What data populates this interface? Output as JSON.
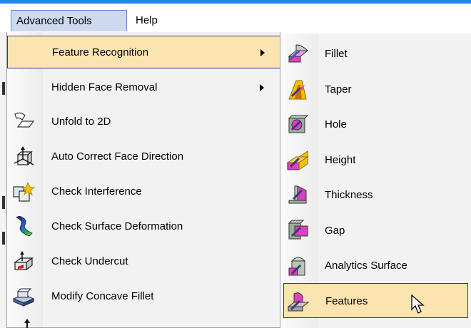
{
  "menubar": {
    "items": [
      {
        "label": "Advanced Tools"
      },
      {
        "label": "Help"
      }
    ]
  },
  "dropdown": {
    "items": [
      {
        "label": "Feature Recognition",
        "icon": "",
        "submenu": true,
        "highlighted": true
      },
      {
        "label": "Hidden Face Removal",
        "icon": "",
        "submenu": true
      },
      {
        "label": "Unfold to 2D",
        "icon": "unfold-icon"
      },
      {
        "label": "Auto Correct Face Direction",
        "icon": "face-direction-icon"
      },
      {
        "label": "Check Interference",
        "icon": "interference-icon"
      },
      {
        "label": "Check Surface Deformation",
        "icon": "surface-deformation-icon"
      },
      {
        "label": "Check Undercut",
        "icon": "undercut-icon"
      },
      {
        "label": "Modify Concave Fillet",
        "icon": "concave-fillet-icon"
      }
    ]
  },
  "submenu": {
    "items": [
      {
        "label": "Fillet",
        "icon": "fillet-icon"
      },
      {
        "label": "Taper",
        "icon": "taper-icon"
      },
      {
        "label": "Hole",
        "icon": "hole-icon"
      },
      {
        "label": "Height",
        "icon": "height-icon"
      },
      {
        "label": "Thickness",
        "icon": "thickness-icon"
      },
      {
        "label": "Gap",
        "icon": "gap-icon"
      },
      {
        "label": "Analytics Surface",
        "icon": "analytics-surface-icon"
      },
      {
        "label": "Features",
        "icon": "features-icon",
        "highlighted": true
      }
    ]
  },
  "colors": {
    "accent_strip": "#1e88e5",
    "highlight_bg": "#fce4b0",
    "highlight_border": "#2c3e7a",
    "menu_bg": "#f2f2f2",
    "active_menubar_bg": "#ccd9ee"
  }
}
